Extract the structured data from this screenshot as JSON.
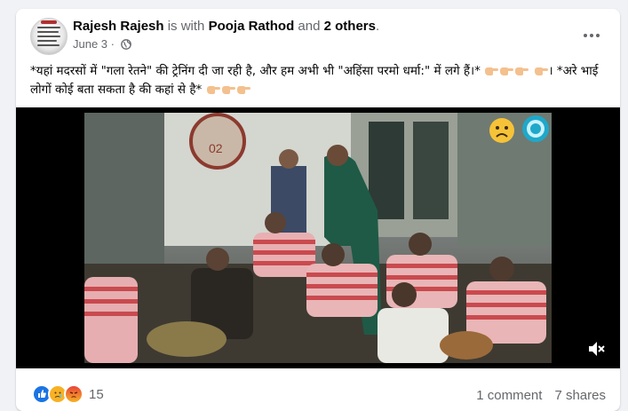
{
  "post": {
    "author": "Rajesh Rajesh",
    "with_text": "is with",
    "tagged": "Pooja Rathod",
    "and_text": "and",
    "others": "2 others",
    "period": ".",
    "date": "June 3",
    "date_sep": "·",
    "privacy_icon": "globe-icon",
    "text_line1": "*यहां मदरसों में \"गला रेतने\" की ट्रेनिंग दी जा रही है, और हम अभी भी \"अहिंसा परमो धर्मा:\" में लगे हैं।*",
    "text_line2_a": "। *अरे भाई लोगों कोई बता सकता है की कहां से है*",
    "emoji_name": "backhand-index-pointing-right"
  },
  "video": {
    "overlay_icons": [
      "sad-face-icon",
      "spiky-circle-icon"
    ],
    "volume_icon": "volume-muted-icon"
  },
  "footer": {
    "reaction_icons": [
      "like-icon",
      "care-icon",
      "angry-icon"
    ],
    "reaction_count": "15",
    "comments": "1 comment",
    "shares": "7 shares"
  },
  "colors": {
    "like": "#1b74e4",
    "care": "#f7b125",
    "angry": "#e9710f",
    "muted_text": "#65676b"
  }
}
